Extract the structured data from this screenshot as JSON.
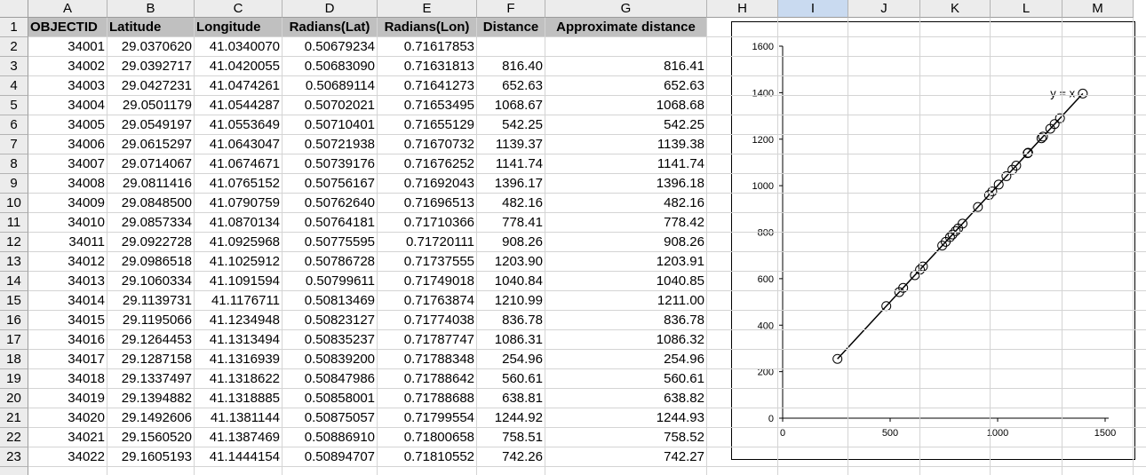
{
  "columns": [
    "A",
    "B",
    "C",
    "D",
    "E",
    "F",
    "G",
    "H",
    "I",
    "J",
    "K",
    "L",
    "M"
  ],
  "selected_column": "I",
  "headers": [
    "OBJECTID",
    "Latitude",
    "Longitude",
    "Radians(Lat)",
    "Radians(Lon)",
    "Distance",
    "Approximate distance"
  ],
  "rows": [
    {
      "n": "2",
      "cells": [
        "34001",
        "29.0370620",
        "41.0340070",
        "0.50679234",
        "0.71617853",
        "",
        ""
      ]
    },
    {
      "n": "3",
      "cells": [
        "34002",
        "29.0392717",
        "41.0420055",
        "0.50683090",
        "0.71631813",
        "816.40",
        "816.41"
      ]
    },
    {
      "n": "4",
      "cells": [
        "34003",
        "29.0427231",
        "41.0474261",
        "0.50689114",
        "0.71641273",
        "652.63",
        "652.63"
      ]
    },
    {
      "n": "5",
      "cells": [
        "34004",
        "29.0501179",
        "41.0544287",
        "0.50702021",
        "0.71653495",
        "1068.67",
        "1068.68"
      ]
    },
    {
      "n": "6",
      "cells": [
        "34005",
        "29.0549197",
        "41.0553649",
        "0.50710401",
        "0.71655129",
        "542.25",
        "542.25"
      ]
    },
    {
      "n": "7",
      "cells": [
        "34006",
        "29.0615297",
        "41.0643047",
        "0.50721938",
        "0.71670732",
        "1139.37",
        "1139.38"
      ]
    },
    {
      "n": "8",
      "cells": [
        "34007",
        "29.0714067",
        "41.0674671",
        "0.50739176",
        "0.71676252",
        "1141.74",
        "1141.74"
      ]
    },
    {
      "n": "9",
      "cells": [
        "34008",
        "29.0811416",
        "41.0765152",
        "0.50756167",
        "0.71692043",
        "1396.17",
        "1396.18"
      ]
    },
    {
      "n": "10",
      "cells": [
        "34009",
        "29.0848500",
        "41.0790759",
        "0.50762640",
        "0.71696513",
        "482.16",
        "482.16"
      ]
    },
    {
      "n": "11",
      "cells": [
        "34010",
        "29.0857334",
        "41.0870134",
        "0.50764181",
        "0.71710366",
        "778.41",
        "778.42"
      ]
    },
    {
      "n": "12",
      "cells": [
        "34011",
        "29.0922728",
        "41.0925968",
        "0.50775595",
        "0.71720111",
        "908.26",
        "908.26"
      ]
    },
    {
      "n": "13",
      "cells": [
        "34012",
        "29.0986518",
        "41.1025912",
        "0.50786728",
        "0.71737555",
        "1203.90",
        "1203.91"
      ]
    },
    {
      "n": "14",
      "cells": [
        "34013",
        "29.1060334",
        "41.1091594",
        "0.50799611",
        "0.71749018",
        "1040.84",
        "1040.85"
      ]
    },
    {
      "n": "15",
      "cells": [
        "34014",
        "29.1139731",
        "41.1176711",
        "0.50813469",
        "0.71763874",
        "1210.99",
        "1211.00"
      ]
    },
    {
      "n": "16",
      "cells": [
        "34015",
        "29.1195066",
        "41.1234948",
        "0.50823127",
        "0.71774038",
        "836.78",
        "836.78"
      ]
    },
    {
      "n": "17",
      "cells": [
        "34016",
        "29.1264453",
        "41.1313494",
        "0.50835237",
        "0.71787747",
        "1086.31",
        "1086.32"
      ]
    },
    {
      "n": "18",
      "cells": [
        "34017",
        "29.1287158",
        "41.1316939",
        "0.50839200",
        "0.71788348",
        "254.96",
        "254.96"
      ]
    },
    {
      "n": "19",
      "cells": [
        "34018",
        "29.1337497",
        "41.1318622",
        "0.50847986",
        "0.71788642",
        "560.61",
        "560.61"
      ]
    },
    {
      "n": "20",
      "cells": [
        "34019",
        "29.1394882",
        "41.1318885",
        "0.50858001",
        "0.71788688",
        "638.81",
        "638.82"
      ]
    },
    {
      "n": "21",
      "cells": [
        "34020",
        "29.1492606",
        "41.1381144",
        "0.50875057",
        "0.71799554",
        "1244.92",
        "1244.93"
      ]
    },
    {
      "n": "22",
      "cells": [
        "34021",
        "29.1560520",
        "41.1387469",
        "0.50886910",
        "0.71800658",
        "758.51",
        "758.52"
      ]
    },
    {
      "n": "23",
      "cells": [
        "34022",
        "29.1605193",
        "41.1444154",
        "0.50894707",
        "0.71810552",
        "742.26",
        "742.27"
      ]
    }
  ],
  "chart_data": {
    "type": "scatter",
    "title": "",
    "xlabel": "",
    "ylabel": "",
    "xlim": [
      0,
      1500
    ],
    "ylim": [
      0,
      1600
    ],
    "xticks": [
      "0",
      "500",
      "1000",
      "1500"
    ],
    "yticks": [
      "0",
      "200",
      "400",
      "600",
      "800",
      "1000",
      "1200",
      "1400",
      "1600"
    ],
    "grid": false,
    "annotation": "y = x",
    "line": {
      "x": [
        254.96,
        1396.17
      ],
      "y": [
        254.96,
        1396.18
      ]
    },
    "points": [
      {
        "x": 816.4,
        "y": 816.41
      },
      {
        "x": 652.63,
        "y": 652.63
      },
      {
        "x": 1068.67,
        "y": 1068.68
      },
      {
        "x": 542.25,
        "y": 542.25
      },
      {
        "x": 1139.37,
        "y": 1139.38
      },
      {
        "x": 1141.74,
        "y": 1141.74
      },
      {
        "x": 1396.17,
        "y": 1396.18
      },
      {
        "x": 482.16,
        "y": 482.16
      },
      {
        "x": 778.41,
        "y": 778.42
      },
      {
        "x": 908.26,
        "y": 908.26
      },
      {
        "x": 1203.9,
        "y": 1203.91
      },
      {
        "x": 1040.84,
        "y": 1040.85
      },
      {
        "x": 1210.99,
        "y": 1211.0
      },
      {
        "x": 836.78,
        "y": 836.78
      },
      {
        "x": 1086.31,
        "y": 1086.32
      },
      {
        "x": 254.96,
        "y": 254.96
      },
      {
        "x": 560.61,
        "y": 560.61
      },
      {
        "x": 638.81,
        "y": 638.82
      },
      {
        "x": 1244.92,
        "y": 1244.93
      },
      {
        "x": 758.51,
        "y": 758.52
      },
      {
        "x": 742.26,
        "y": 742.27
      },
      {
        "x": 960.0,
        "y": 960.0
      },
      {
        "x": 975.0,
        "y": 975.0
      },
      {
        "x": 1005.0,
        "y": 1005.0
      },
      {
        "x": 1265.0,
        "y": 1265.0
      },
      {
        "x": 1290.0,
        "y": 1290.0
      },
      {
        "x": 615.0,
        "y": 615.0
      },
      {
        "x": 790.0,
        "y": 790.0
      },
      {
        "x": 805.0,
        "y": 805.0
      }
    ]
  }
}
